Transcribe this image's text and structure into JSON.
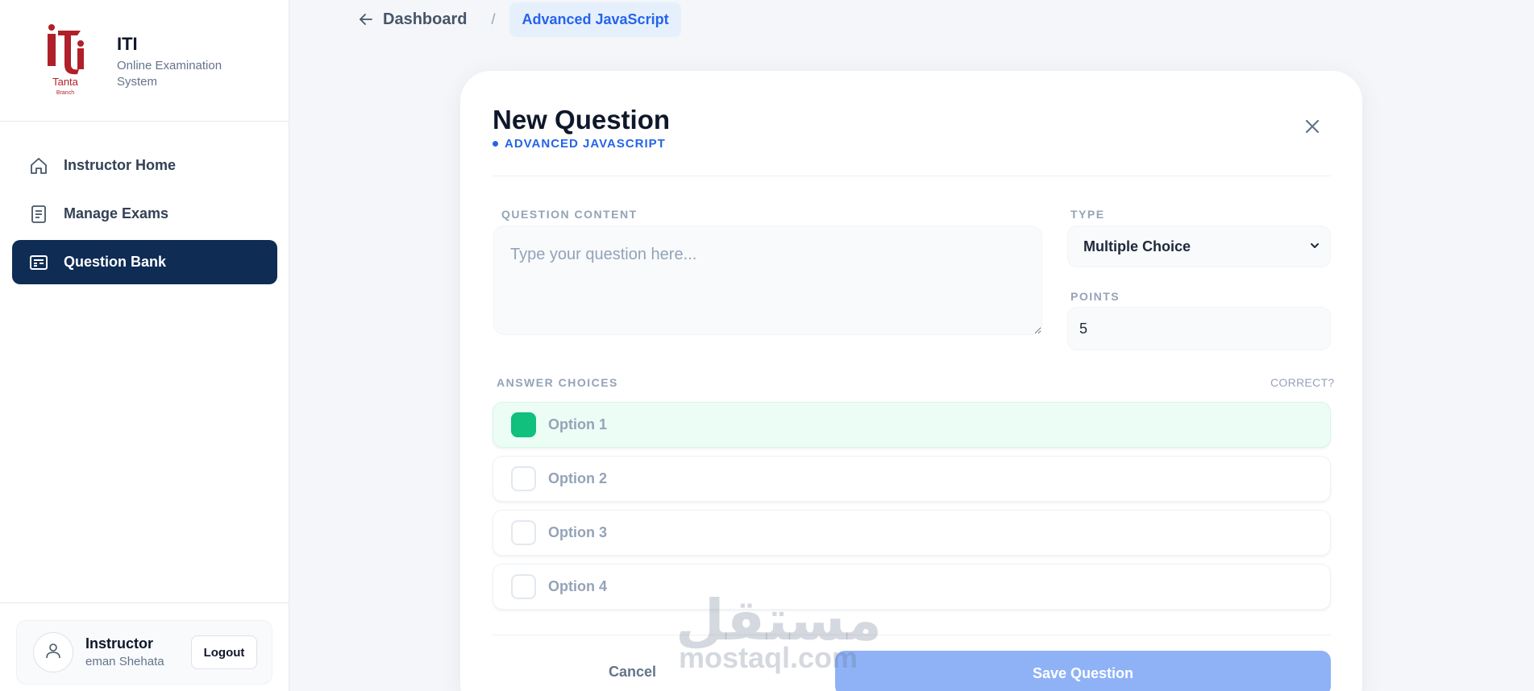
{
  "brand": {
    "title": "ITI",
    "subtitle": "Online Examination System",
    "logo_text": "Tanta",
    "logo_subtext": "Branch"
  },
  "sidebar": {
    "items": [
      {
        "label": "Instructor Home",
        "icon": "home-icon"
      },
      {
        "label": "Manage Exams",
        "icon": "document-icon"
      },
      {
        "label": "Question Bank",
        "icon": "question-bank-icon",
        "active": true
      }
    ]
  },
  "user": {
    "role": "Instructor",
    "name": "eman Shehata",
    "logout_label": "Logout"
  },
  "breadcrumb": {
    "back_label": "Dashboard",
    "separator": "/",
    "current": "Advanced JavaScript"
  },
  "modal": {
    "title": "New Question",
    "subtitle": "ADVANCED JAVASCRIPT",
    "question_label": "QUESTION CONTENT",
    "question_placeholder": "Type your question here...",
    "type_label": "TYPE",
    "type_value": "Multiple Choice",
    "points_label": "POINTS",
    "points_value": "5",
    "answers_label": "ANSWER CHOICES",
    "correct_label": "CORRECT?",
    "options": [
      {
        "label": "Option 1",
        "correct": true
      },
      {
        "label": "Option 2",
        "correct": false
      },
      {
        "label": "Option 3",
        "correct": false
      },
      {
        "label": "Option 4",
        "correct": false
      }
    ],
    "cancel_label": "Cancel",
    "save_label": "Save Question"
  },
  "watermark": {
    "arabic": "مستقل",
    "latin": "mostaql.com"
  },
  "colors": {
    "accent": "#2563eb",
    "sidebar_active": "#0f2c55",
    "correct_green": "#10c07c",
    "save_button": "#8fb2f7",
    "logo_red": "#b0202a"
  }
}
